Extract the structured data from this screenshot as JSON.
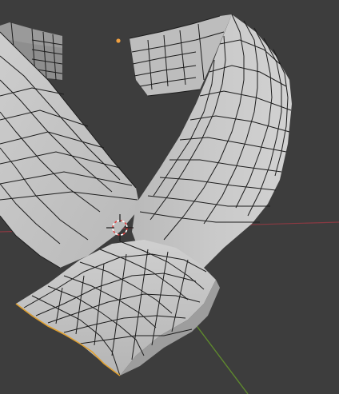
{
  "viewport": {
    "background": "#3d3d3d",
    "x_axis_color": "#8a3a42",
    "y_axis_color": "#5f8a2e",
    "selected_edge_color": "#e0a030",
    "origin_dot_color": "#f0a040",
    "cursor_colors": [
      "#e04040",
      "#ffffff"
    ],
    "mesh_face_color": "#c6c6c6",
    "mesh_edge_color": "#1c1c1c"
  }
}
